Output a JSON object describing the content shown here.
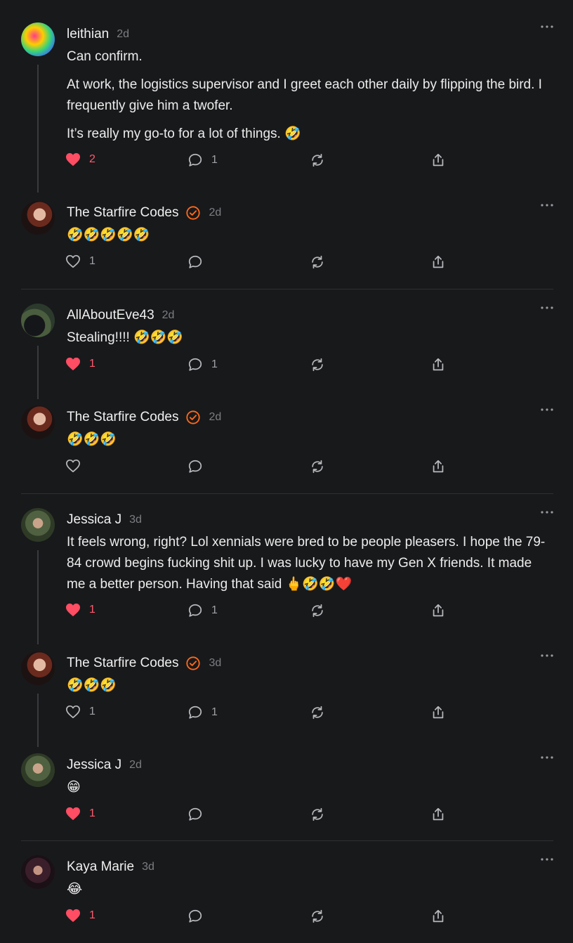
{
  "colors": {
    "background": "#18191b",
    "like_active": "#ff4d64",
    "verified": "#ff6a1a",
    "muted": "#7d7e82"
  },
  "comments": [
    {
      "author": "leithian",
      "time": "2d",
      "verified": false,
      "paragraphs": [
        "Can confirm.",
        "At work, the logistics supervisor and I greet each other daily by flipping the bird. I frequently give him a twofer.",
        "It’s really my go-to for a lot of things. 🤣"
      ],
      "likes": "2",
      "liked": true,
      "replies": "1"
    },
    {
      "author": "The Starfire Codes",
      "time": "2d",
      "verified": true,
      "paragraphs": [
        "🤣🤣🤣🤣🤣"
      ],
      "likes": "1",
      "liked": false,
      "replies": ""
    },
    {
      "author": "AllAboutEve43",
      "time": "2d",
      "verified": false,
      "paragraphs": [
        "Stealing!!!! 🤣🤣🤣"
      ],
      "likes": "1",
      "liked": true,
      "replies": "1"
    },
    {
      "author": "The Starfire Codes",
      "time": "2d",
      "verified": true,
      "paragraphs": [
        "🤣🤣🤣"
      ],
      "likes": "",
      "liked": false,
      "replies": ""
    },
    {
      "author": "Jessica J",
      "time": "3d",
      "verified": false,
      "paragraphs": [
        "It feels wrong, right? Lol xennials were bred to be people pleasers. I hope the 79-84 crowd begins fucking shit up. I was lucky to have my Gen X friends. It made me a better person. Having that said 🖕🤣🤣❤️"
      ],
      "likes": "1",
      "liked": true,
      "replies": "1"
    },
    {
      "author": "The Starfire Codes",
      "time": "3d",
      "verified": true,
      "paragraphs": [
        "🤣🤣🤣"
      ],
      "likes": "1",
      "liked": false,
      "replies": "1"
    },
    {
      "author": "Jessica J",
      "time": "2d",
      "verified": false,
      "paragraphs": [
        "😁"
      ],
      "likes": "1",
      "liked": true,
      "replies": ""
    },
    {
      "author": "Kaya Marie",
      "time": "3d",
      "verified": false,
      "paragraphs": [
        "😂"
      ],
      "likes": "1",
      "liked": true,
      "replies": ""
    }
  ]
}
